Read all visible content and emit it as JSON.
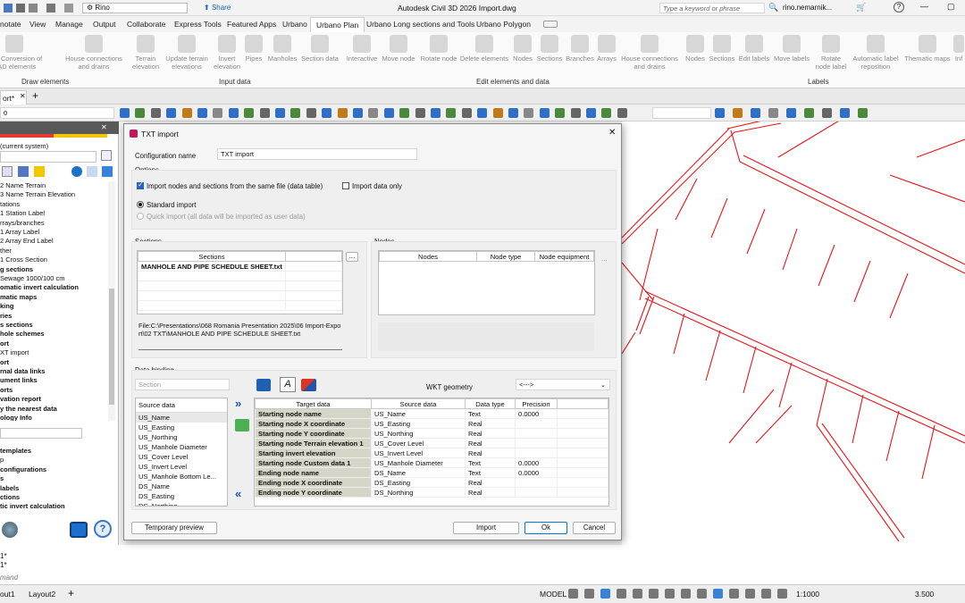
{
  "app": {
    "title": "Autodesk Civil 3D 2026   Import.dwg",
    "workspace": "Rino",
    "share": "Share",
    "search_placeholder": "Type a keyword or phrase",
    "user": "rino.nemarnik...",
    "help": "?"
  },
  "menu_tabs": [
    "notate",
    "View",
    "Manage",
    "Output",
    "Collaborate",
    "Express Tools",
    "Featured Apps",
    "Urbano",
    "Urbano Plan",
    "Urbano Long sections and Tools",
    "Urbano Polygon"
  ],
  "ribbon": {
    "buttons": [
      {
        "label": "ents Conversion of\nCAD elements"
      },
      {
        "label": "House connections\nand drains"
      },
      {
        "label": "Terrain\nelevation"
      },
      {
        "label": "Update terrain\nelevations"
      },
      {
        "label": "Invert\nelevation"
      },
      {
        "label": "Pipes"
      },
      {
        "label": "Manholes"
      },
      {
        "label": "Section data"
      },
      {
        "label": "Interactive"
      },
      {
        "label": "Move node"
      },
      {
        "label": "Rotate node"
      },
      {
        "label": "Delete elements"
      },
      {
        "label": "Nodes"
      },
      {
        "label": "Sections"
      },
      {
        "label": "Branches"
      },
      {
        "label": "Arrays"
      },
      {
        "label": "House connections\nand drains"
      },
      {
        "label": "Nodes"
      },
      {
        "label": "Sections"
      },
      {
        "label": "Edit labels"
      },
      {
        "label": "Move labels"
      },
      {
        "label": "Rotate\nnode label"
      },
      {
        "label": "Automatic label\nreposition"
      },
      {
        "label": "Thematic maps"
      },
      {
        "label": "Inf"
      }
    ],
    "groups": [
      "Draw elements",
      "Input data",
      "Edit elements and data",
      "Labels"
    ]
  },
  "doc_tab": "ort*",
  "layer_combo": "0",
  "left_panel": {
    "header": "(current system)",
    "tree": [
      {
        "t": "2 Name Terrain",
        "b": false
      },
      {
        "t": "3 Name Terrain Elevation",
        "b": false
      },
      {
        "t": "tations",
        "b": false
      },
      {
        "t": "1 Station Label",
        "b": false
      },
      {
        "t": "rrays/branches",
        "b": false
      },
      {
        "t": "1 Array Label",
        "b": false
      },
      {
        "t": "2 Array End Label",
        "b": false
      },
      {
        "t": "ther",
        "b": false
      },
      {
        "t": "1 Cross Section",
        "b": false
      },
      {
        "t": "g sections",
        "b": true
      },
      {
        "t": "Sewage 1000/100 cm",
        "b": false
      },
      {
        "t": "omatic invert calculation",
        "b": true
      },
      {
        "t": "matic maps",
        "b": true
      },
      {
        "t": "king",
        "b": true
      },
      {
        "t": "ries",
        "b": true
      },
      {
        "t": "s sections",
        "b": true
      },
      {
        "t": "hole schemes",
        "b": true
      },
      {
        "t": "ort",
        "b": true
      },
      {
        "t": "XT import",
        "b": false
      },
      {
        "t": "ort",
        "b": true
      },
      {
        "t": "rnal data links",
        "b": true
      },
      {
        "t": "ument links",
        "b": true
      },
      {
        "t": "orts",
        "b": true
      },
      {
        "t": "vation report",
        "b": true
      },
      {
        "t": "y the nearest data",
        "b": true
      },
      {
        "t": "ology Info",
        "b": true
      }
    ],
    "lower": [
      {
        "t": "templates",
        "b": true
      },
      {
        "t": "p",
        "b": false
      },
      {
        "t": "configurations",
        "b": true
      },
      {
        "t": "s",
        "b": true
      },
      {
        "t": "labels",
        "b": true
      },
      {
        "t": "ctions",
        "b": true
      },
      {
        "t": "tic invert calculation",
        "b": true
      }
    ]
  },
  "command_line": {
    "lines": [
      "1*",
      "1*"
    ],
    "prompt": "mand"
  },
  "layout_tabs": [
    "out1",
    "Layout2"
  ],
  "status": {
    "model": "MODEL",
    "scale": "1:1000",
    "value": "3.500"
  },
  "dialog": {
    "title": "TXT import",
    "config_label": "Configuration name",
    "config_value": "TXT import",
    "options_label": "Options",
    "opt1": "Import nodes and sections from the same file (data table)",
    "opt2": "Import data only",
    "radio1": "Standard import",
    "radio2": "Quick import (all data will be imported as user data)",
    "sections_label": "Sections",
    "sections_header": "Sections",
    "sections_rows": [
      "MANHOLE AND PIPE SCHEDULE SHEET.txt"
    ],
    "file_path": "File:C:\\Presentations\\068 Romania Presentation 2025\\06 Import-Export\\02 TXT\\MANHOLE AND PIPE SCHEDULE SHEET.txt",
    "nodes_label": "Nodes",
    "nodes_headers": [
      "Nodes",
      "Node type",
      "Node equipment"
    ],
    "ellipsis": "...",
    "binding_label": "Data binding",
    "section_combo": "Section",
    "wkt_label": "WKT geometry",
    "wkt_value": "<--->",
    "source_list_title": "Source data",
    "source_list": [
      "US_Name",
      "US_Easting",
      "US_Northing",
      "US_Manhole Diameter",
      "US_Cover Level",
      "US_Invert Level",
      "US_Manhole Bottom Le...",
      "DS_Name",
      "DS_Easting",
      "DS_Northing"
    ],
    "binding_headers": [
      "Target data",
      "Source data",
      "Data type",
      "Precision"
    ],
    "binding_rows": [
      [
        "Starting node name",
        "US_Name",
        "Text",
        "0.0000"
      ],
      [
        "Starting node X coordinate",
        "US_Easting",
        "Real",
        ""
      ],
      [
        "Starting node Y coordinate",
        "US_Northing",
        "Real",
        ""
      ],
      [
        "Starting node Terrain elevation 1",
        "US_Cover Level",
        "Real",
        ""
      ],
      [
        "Starting invert elevation",
        "US_Invert Level",
        "Real",
        ""
      ],
      [
        "Starting node Custom data 1",
        "US_Manhole Diameter",
        "Text",
        "0.0000"
      ],
      [
        "Ending node name",
        "DS_Name",
        "Text",
        "0.0000"
      ],
      [
        "Ending node X coordinate",
        "DS_Easting",
        "Real",
        ""
      ],
      [
        "Ending node Y coordinate",
        "DS_Northing",
        "Real",
        ""
      ]
    ],
    "btn_preview": "Temporary preview",
    "btn_import": "Import",
    "btn_ok": "Ok",
    "btn_cancel": "Cancel"
  }
}
